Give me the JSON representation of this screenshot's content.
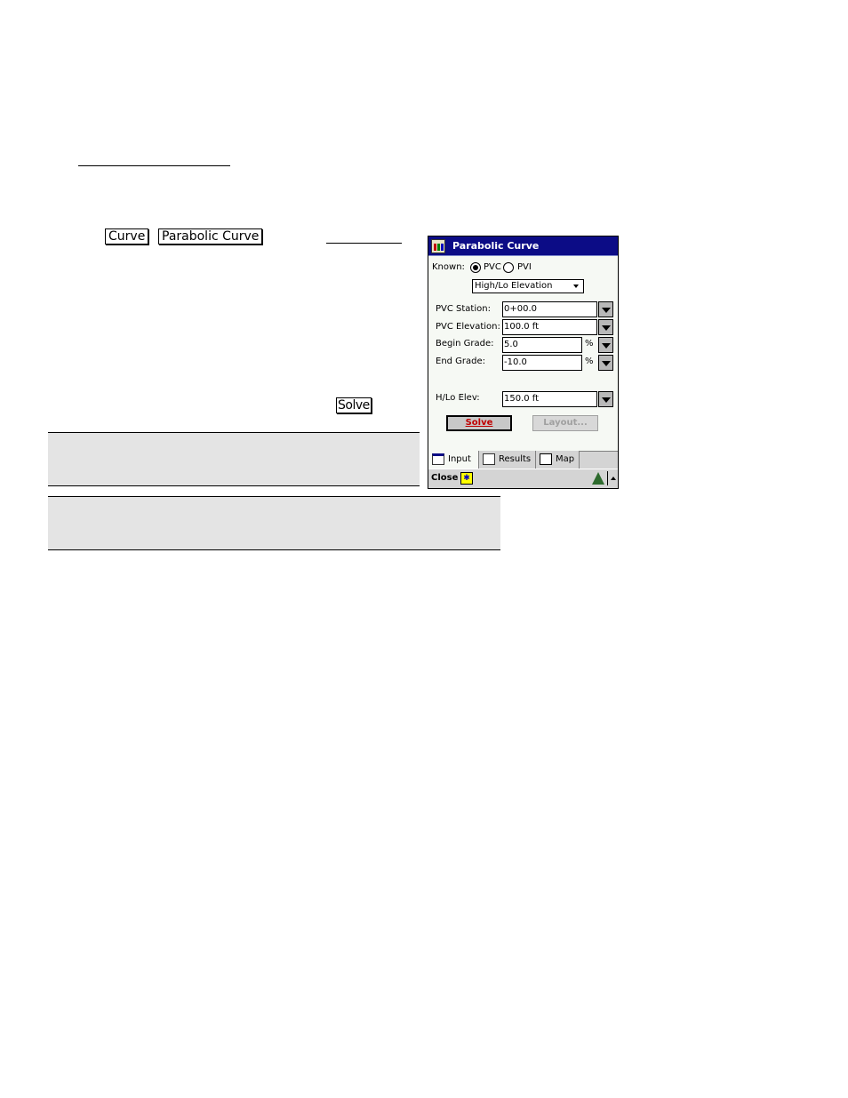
{
  "document": {
    "step_keys": [
      "Curve",
      "Parabolic Curve"
    ],
    "solve_key": "Solve"
  },
  "device": {
    "title": "Parabolic Curve",
    "known_label": "Known:",
    "known_options": [
      {
        "label": "PVC",
        "checked": true
      },
      {
        "label": "PVI",
        "checked": false
      }
    ],
    "mode_select": "High/Lo Elevation",
    "fields": [
      {
        "label": "PVC Station:",
        "value": "0+00.0",
        "unit": ""
      },
      {
        "label": "PVC Elevation:",
        "value": "100.0 ft",
        "unit": ""
      },
      {
        "label": "Begin Grade:",
        "value": "5.0",
        "unit": "%"
      },
      {
        "label": "End Grade:",
        "value": "-10.0",
        "unit": "%"
      }
    ],
    "hilo_field": {
      "label": "H/Lo Elev:",
      "value": "150.0 ft"
    },
    "buttons": {
      "solve": "Solve",
      "layout": "Layout..."
    },
    "tabs": [
      {
        "label": "Input",
        "icon": "input-form-icon",
        "active": true
      },
      {
        "label": "Results",
        "icon": "results-document-icon",
        "active": false
      },
      {
        "label": "Map",
        "icon": "map-icon",
        "active": false
      }
    ],
    "command_bar": {
      "close": "Close",
      "sip_icon": "keyboard-sip-icon"
    },
    "colors": {
      "titlebar": "#0c0c86",
      "solve_text": "#c00000",
      "form_bg": "#f6f9f4"
    }
  }
}
